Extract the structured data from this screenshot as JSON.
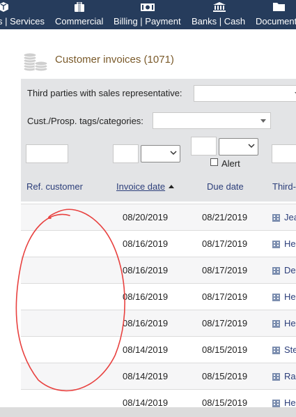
{
  "nav": {
    "items": [
      {
        "label": "s | Services",
        "icon": "cube-icon"
      },
      {
        "label": "Commercial",
        "icon": "briefcase-icon"
      },
      {
        "label": "Billing | Payment",
        "icon": "banknote-icon"
      },
      {
        "label": "Banks | Cash",
        "icon": "bank-icon"
      },
      {
        "label": "Documents",
        "icon": "folder-icon"
      }
    ]
  },
  "page": {
    "title": "Customer invoices (1071)",
    "title_icon": "coins-icon"
  },
  "filters": {
    "sales_rep_label": "Third parties with sales representative:",
    "tags_label": "Cust./Prosp. tags/categories:",
    "alert_label": "Alert"
  },
  "columns": {
    "ref_customer": "Ref. customer",
    "invoice_date": "Invoice date",
    "due_date": "Due date",
    "third_party": "Third-"
  },
  "rows": [
    {
      "invoice_date": "08/20/2019",
      "due_date": "08/21/2019",
      "third_party": "Jea"
    },
    {
      "invoice_date": "08/16/2019",
      "due_date": "08/17/2019",
      "third_party": "He"
    },
    {
      "invoice_date": "08/16/2019",
      "due_date": "08/17/2019",
      "third_party": "De"
    },
    {
      "invoice_date": "08/16/2019",
      "due_date": "08/17/2019",
      "third_party": "He"
    },
    {
      "invoice_date": "08/16/2019",
      "due_date": "08/17/2019",
      "third_party": "He"
    },
    {
      "invoice_date": "08/14/2019",
      "due_date": "08/15/2019",
      "third_party": "Ste"
    },
    {
      "invoice_date": "08/14/2019",
      "due_date": "08/15/2019",
      "third_party": "Ra"
    },
    {
      "invoice_date": "08/14/2019",
      "due_date": "08/15/2019",
      "third_party": "He"
    }
  ],
  "colors": {
    "nav_bg": "#263c5c",
    "title": "#7a5a2a",
    "link": "#2c3e7a",
    "annotation": "#e8413f"
  }
}
